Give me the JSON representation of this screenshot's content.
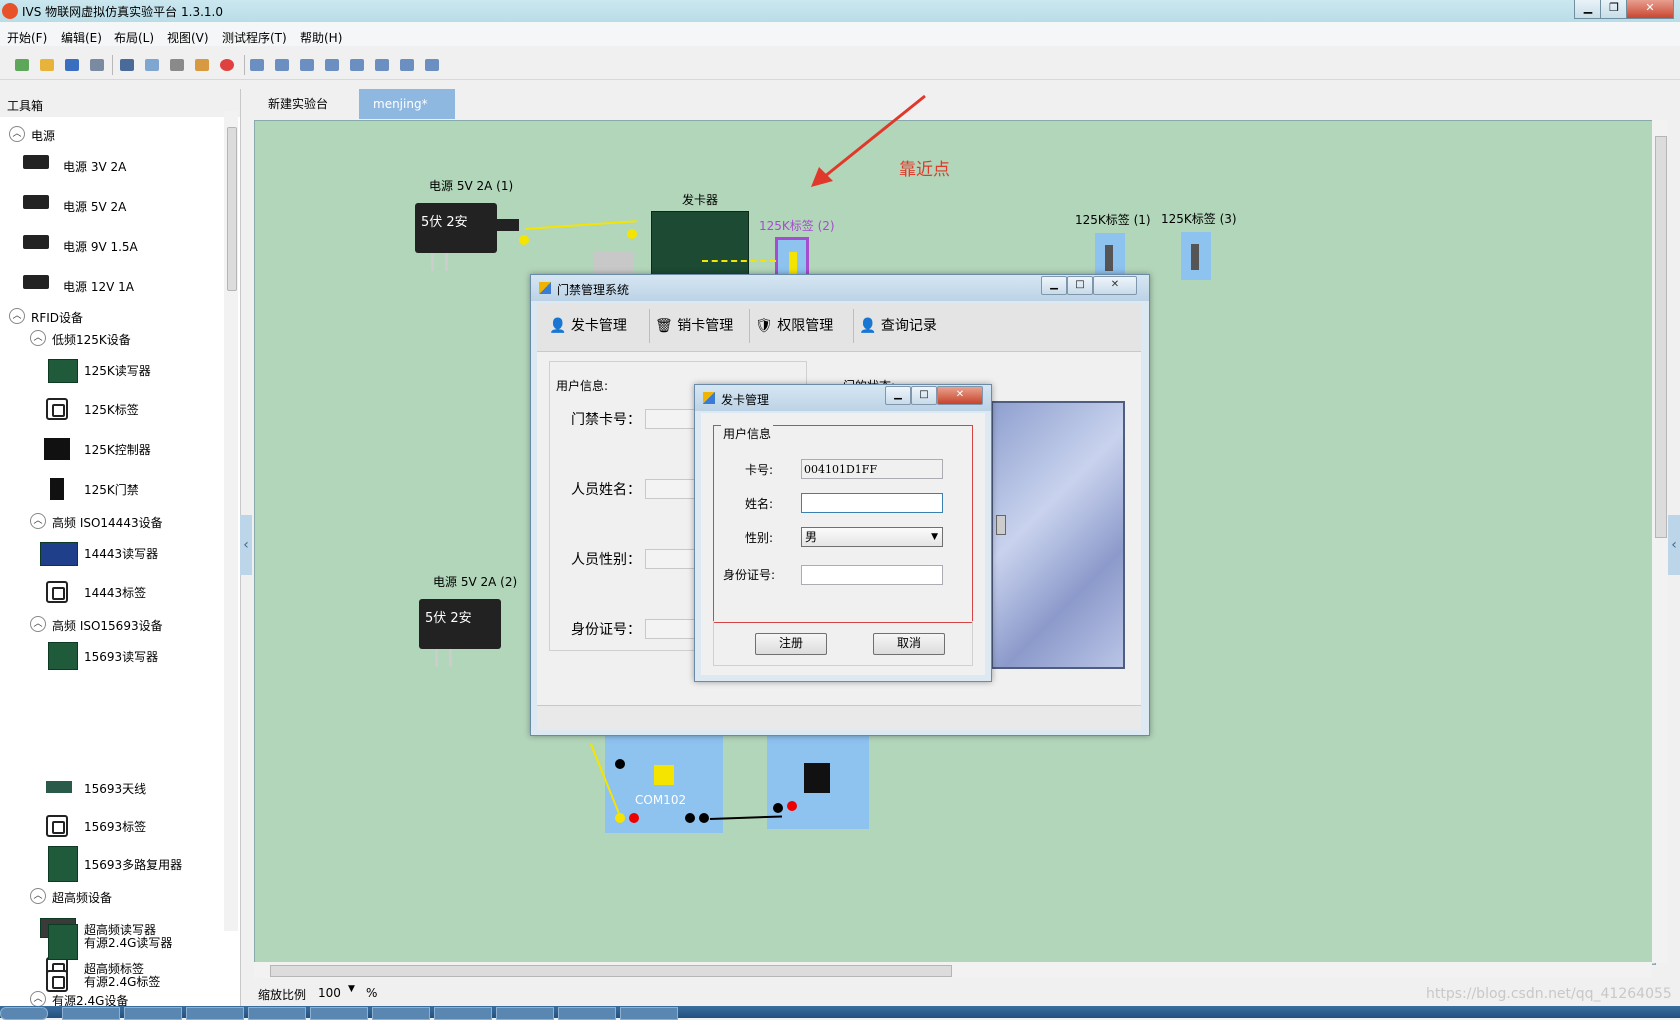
{
  "window": {
    "title": "IVS 物联网虚拟仿真实验平台 1.3.1.0",
    "minimize": "▁",
    "maximize": "❐",
    "close": "✕"
  },
  "menu": [
    "开始(F)",
    "编辑(E)",
    "布局(L)",
    "视图(V)",
    "测试程序(T)",
    "帮助(H)"
  ],
  "toolbox": {
    "title": "工具箱",
    "power_group": "电源",
    "power_items": [
      "电源 3V   2A",
      "电源 5V   2A",
      "电源 9V 1.5A",
      "电源 12V  1A"
    ],
    "rfid_group": "RFID设备",
    "lf_group": "低频125K设备",
    "lf_items": [
      "125K读写器",
      "125K标签",
      "125K控制器",
      "125K门禁"
    ],
    "hf14443_group": "高频 ISO14443设备",
    "hf14443_items": [
      "14443读写器",
      "14443标签"
    ],
    "hf15693_group": "高频 ISO15693设备",
    "hf15693_items": [
      "15693读写器",
      "15693天线",
      "15693标签",
      "15693多路复用器"
    ],
    "uhf_group": "超高频设备",
    "uhf_items": [
      "超高频读写器",
      "超高频标签"
    ],
    "active24_group": "有源2.4G设备",
    "active24_items": [
      "有源2.4G读写器",
      "有源2.4G标签"
    ]
  },
  "tabs": [
    "新建实验台",
    "menjing*"
  ],
  "canvas": {
    "psu1_label": "电源 5V   2A (1)",
    "psu1_text": "5伏  2安",
    "card_issuer_label": "发卡器",
    "tag2_label": "125K标签 (2)",
    "annotation": "靠近点",
    "tag1_label": "125K标签 (1)",
    "tag3_label": "125K标签 (3)",
    "psu2_label": "电源 5V   2A (2)",
    "psu2_text": "5伏  2安",
    "com_label": "COM102"
  },
  "access_window": {
    "title": "门禁管理系统",
    "toolbar": [
      "发卡管理",
      "销卡管理",
      "权限管理",
      "查询记录"
    ],
    "user_info_label": "用户信息:",
    "door_status_label": "门的状态:",
    "fields": [
      "门禁卡号：",
      "人员姓名：",
      "人员性别：",
      "身份证号："
    ]
  },
  "issue_dialog": {
    "title": "发卡管理",
    "group_label": "用户信息",
    "card_label": "卡号:",
    "card_value": "004101D1FF",
    "name_label": "姓名:",
    "name_value": "",
    "gender_label": "性别:",
    "gender_value": "男",
    "id_label": "身份证号:",
    "id_value": "",
    "register_button": "注册",
    "cancel_button": "取消"
  },
  "status": {
    "zoom_label": "缩放比例",
    "zoom_value": "100",
    "percent": "%"
  },
  "watermark": "https://blog.csdn.net/qq_41264055",
  "colors": {
    "canvas_bg": "#b2d6ba",
    "annotation": "#e0392b",
    "tag_highlight": "#a64ccf",
    "wire": "#f5e400"
  }
}
